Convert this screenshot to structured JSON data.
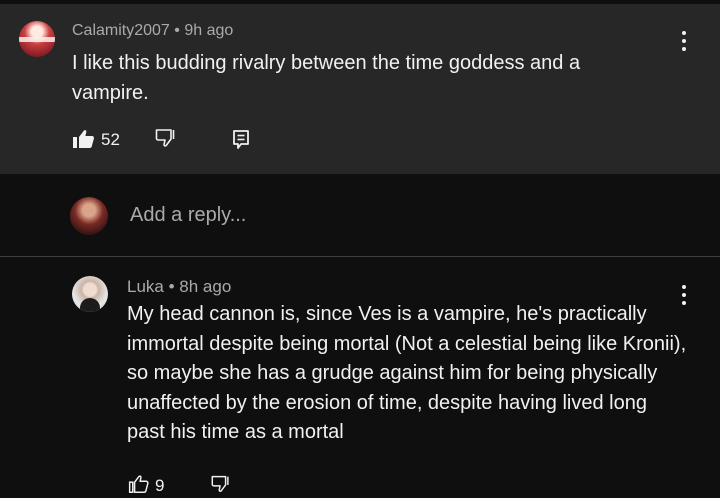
{
  "comment": {
    "author": "Calamity2007",
    "time": "9h ago",
    "text": "I like this budding rivalry between the time goddess and a vampire.",
    "likes": "52",
    "icons": {
      "like": "thumbs-up-filled-icon",
      "dislike": "thumbs-down-icon",
      "reply": "reply-icon",
      "menu": "more-vert-icon"
    }
  },
  "reply_box": {
    "placeholder": "Add a reply...",
    "avatar_icon": "user-avatar-icon"
  },
  "reply": {
    "author": "Luka",
    "time": "8h ago",
    "text": "My head cannon is, since Ves is a vampire, he's practically immortal despite being mortal (Not a celestial being like Kronii), so maybe she has a grudge against him for being physically unaffected by the erosion of time, despite having lived long past his time as a mortal",
    "likes": "9",
    "icons": {
      "like": "thumbs-up-outline-icon",
      "dislike": "thumbs-down-icon",
      "menu": "more-vert-icon"
    }
  },
  "colors": {
    "background": "#0f0f0f",
    "card": "#272727",
    "text": "#f1f1f1",
    "secondary_text": "#aaaaaa",
    "divider": "#3f3f3f"
  }
}
